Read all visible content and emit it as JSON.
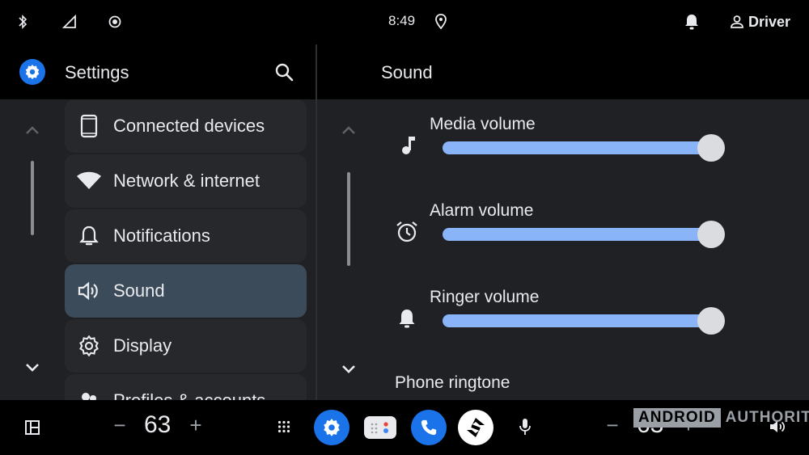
{
  "status_bar": {
    "time": "8:49",
    "user": "Driver",
    "icons": [
      "bluetooth-icon",
      "signal-icon",
      "brightness-icon",
      "location-icon",
      "notification-bell-icon",
      "person-icon"
    ]
  },
  "left_pane": {
    "title": "Settings",
    "menu_items": [
      {
        "label": "Connected devices",
        "icon": "phone-icon"
      },
      {
        "label": "Network & internet",
        "icon": "wifi-icon"
      },
      {
        "label": "Notifications",
        "icon": "bell-icon"
      },
      {
        "label": "Sound",
        "icon": "speaker-icon",
        "active": true
      },
      {
        "label": "Display",
        "icon": "gear-icon"
      },
      {
        "label": "Profiles & accounts",
        "icon": "profiles-icon"
      }
    ]
  },
  "right_pane": {
    "title": "Sound",
    "volumes": [
      {
        "label": "Media volume",
        "icon": "music-note-icon",
        "level": 1.0
      },
      {
        "label": "Alarm volume",
        "icon": "alarm-clock-icon",
        "level": 1.0
      },
      {
        "label": "Ringer volume",
        "icon": "bell-icon",
        "level": 1.0
      }
    ],
    "ringtone_label": "Phone ringtone"
  },
  "nav_bar": {
    "left_temp": "63",
    "right_temp": "63",
    "minus": "−",
    "plus": "+",
    "watermark_box": "ANDROID",
    "watermark_text": "AUTHORITY"
  },
  "colors": {
    "accent": "#1a73e8",
    "slider_fill": "#8ab4f8",
    "active_item": "#3c4b59"
  }
}
